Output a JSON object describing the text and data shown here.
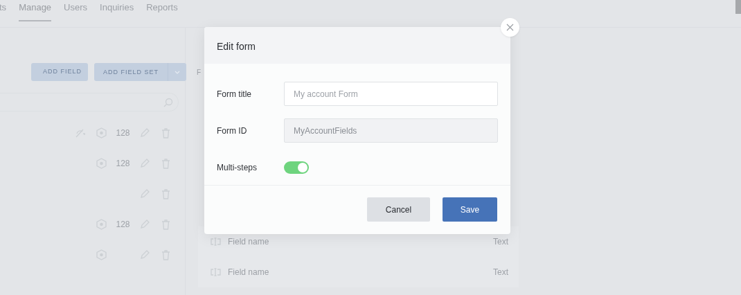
{
  "nav_tabs": [
    {
      "label": "ts",
      "selected": false
    },
    {
      "label": "Manage",
      "selected": true
    },
    {
      "label": "Users",
      "selected": false
    },
    {
      "label": "Inquiries",
      "selected": false
    },
    {
      "label": "Reports",
      "selected": false
    }
  ],
  "toolbar": {
    "add_field": "ADD FIELD",
    "add_field_set": "ADD FIELD SET",
    "cut_label": "F"
  },
  "field_rows": [
    {
      "hidden": true,
      "required": true,
      "count": "128"
    },
    {
      "hidden": false,
      "required": true,
      "count": "128"
    },
    {
      "hidden": false,
      "required": false
    },
    {
      "hidden": false,
      "required": true,
      "count": "128"
    },
    {
      "hidden": false,
      "required": true
    }
  ],
  "preview_rows": [
    {
      "label": "Field name",
      "type": "Text"
    },
    {
      "label": "Field name",
      "type": "Text"
    }
  ],
  "modal": {
    "title": "Edit form",
    "fields": [
      {
        "kind": "text",
        "label": "Form title",
        "placeholder": "My account Form"
      },
      {
        "kind": "readonly",
        "label": "Form ID",
        "value": "MyAccountFields"
      },
      {
        "kind": "switch",
        "label": "Multi-steps",
        "on": true
      }
    ],
    "buttons": [
      {
        "kind": "secondary",
        "label": "Cancel"
      },
      {
        "kind": "primary",
        "label": "Save"
      }
    ]
  }
}
